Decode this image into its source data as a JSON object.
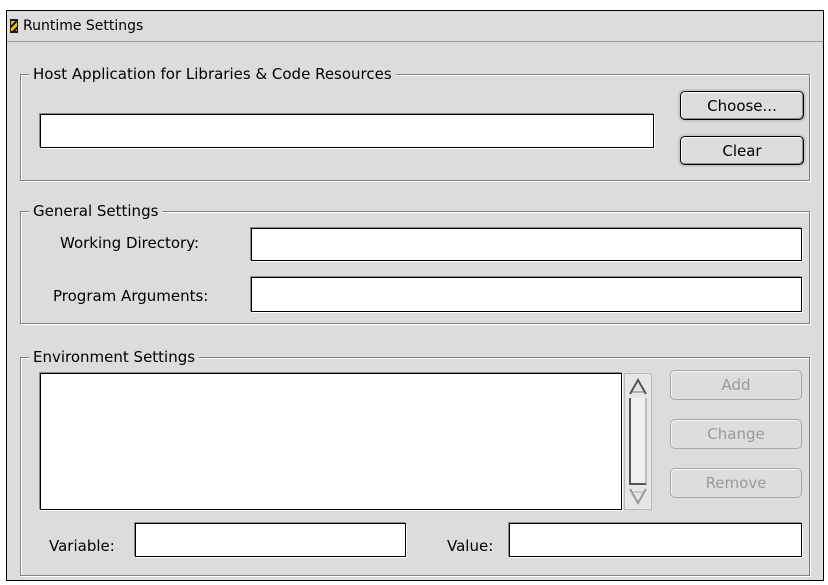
{
  "window": {
    "title": "Runtime Settings"
  },
  "host_application": {
    "group_label": "Host Application for Libraries & Code Resources",
    "path_value": "",
    "choose_label": "Choose...",
    "clear_label": "Clear"
  },
  "general_settings": {
    "group_label": "General Settings",
    "working_directory_label": "Working Directory:",
    "working_directory_value": "",
    "program_arguments_label": "Program Arguments:",
    "program_arguments_value": ""
  },
  "environment_settings": {
    "group_label": "Environment Settings",
    "variables": [],
    "add_label": "Add",
    "change_label": "Change",
    "remove_label": "Remove",
    "variable_label": "Variable:",
    "variable_value": "",
    "value_label": "Value:",
    "value_value": ""
  },
  "colors": {
    "window_bg": "#dcdcdc",
    "disabled_text": "#9a9a9a"
  }
}
